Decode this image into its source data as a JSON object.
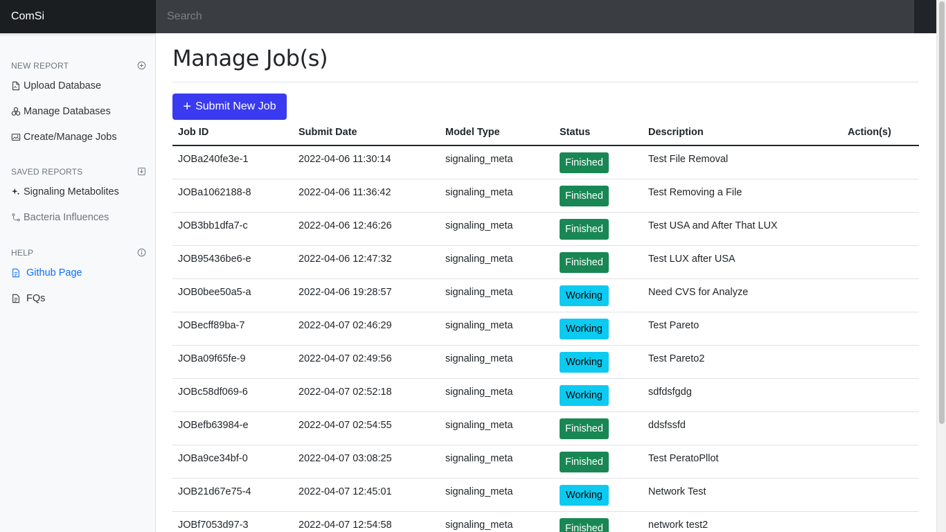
{
  "app": {
    "brand": "ComSi",
    "search_placeholder": "Search"
  },
  "sidebar": {
    "new_report": {
      "heading": "NEW REPORT",
      "items": [
        {
          "label": "Upload Database",
          "icon": "file-upload-icon"
        },
        {
          "label": "Manage Databases",
          "icon": "boxes-icon"
        },
        {
          "label": "Create/Manage Jobs",
          "icon": "image-jobs-icon"
        }
      ]
    },
    "saved_reports": {
      "heading": "SAVED REPORTS",
      "items": [
        {
          "label": "Signaling Metabolites",
          "icon": "sparkles-icon"
        },
        {
          "label": "Bacteria Influences",
          "icon": "branch-icon"
        }
      ]
    },
    "help": {
      "heading": "HELP",
      "items": [
        {
          "label": "Github Page",
          "icon": "document-icon"
        },
        {
          "label": "FQs",
          "icon": "document-icon"
        }
      ]
    }
  },
  "main": {
    "title": "Manage Job(s)",
    "submit_button": "Submit New Job",
    "columns": [
      "Job ID",
      "Submit Date",
      "Model Type",
      "Status",
      "Description",
      "Action(s)"
    ],
    "rows": [
      {
        "id": "JOBa240fe3e-1",
        "date": "2022-04-06 11:30:14",
        "model": "signaling_meta",
        "status": "Finished",
        "desc": "Test File Removal"
      },
      {
        "id": "JOBa1062188-8",
        "date": "2022-04-06 11:36:42",
        "model": "signaling_meta",
        "status": "Finished",
        "desc": "Test Removing a File"
      },
      {
        "id": "JOB3bb1dfa7-c",
        "date": "2022-04-06 12:46:26",
        "model": "signaling_meta",
        "status": "Finished",
        "desc": "Test USA and After That LUX"
      },
      {
        "id": "JOB95436be6-e",
        "date": "2022-04-06 12:47:32",
        "model": "signaling_meta",
        "status": "Finished",
        "desc": "Test LUX after USA"
      },
      {
        "id": "JOB0bee50a5-a",
        "date": "2022-04-06 19:28:57",
        "model": "signaling_meta",
        "status": "Working",
        "desc": "Need CVS for Analyze"
      },
      {
        "id": "JOBecff89ba-7",
        "date": "2022-04-07 02:46:29",
        "model": "signaling_meta",
        "status": "Working",
        "desc": "Test Pareto"
      },
      {
        "id": "JOBa09f65fe-9",
        "date": "2022-04-07 02:49:56",
        "model": "signaling_meta",
        "status": "Working",
        "desc": "Test Pareto2"
      },
      {
        "id": "JOBc58df069-6",
        "date": "2022-04-07 02:52:18",
        "model": "signaling_meta",
        "status": "Working",
        "desc": "sdfdsfgdg"
      },
      {
        "id": "JOBefb63984-e",
        "date": "2022-04-07 02:54:55",
        "model": "signaling_meta",
        "status": "Finished",
        "desc": "ddsfssfd"
      },
      {
        "id": "JOBa9ce34bf-0",
        "date": "2022-04-07 03:08:25",
        "model": "signaling_meta",
        "status": "Finished",
        "desc": "Test PeratoPllot"
      },
      {
        "id": "JOB21d67e75-4",
        "date": "2022-04-07 12:45:01",
        "model": "signaling_meta",
        "status": "Working",
        "desc": "Network Test"
      },
      {
        "id": "JOBf7053d97-3",
        "date": "2022-04-07 12:54:58",
        "model": "signaling_meta",
        "status": "Finished",
        "desc": "network test2"
      }
    ]
  },
  "colors": {
    "primary_button": "#3a3af0",
    "finished": "#198754",
    "working": "#0dcaf0",
    "link": "#0d6efd",
    "topbar": "#212529"
  }
}
